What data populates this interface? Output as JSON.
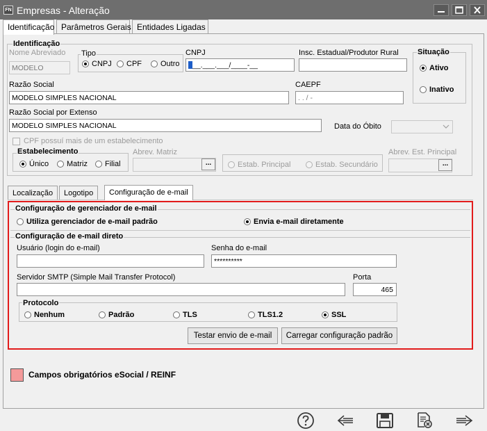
{
  "window": {
    "title": "Empresas - Alteração",
    "logo_text": "FN"
  },
  "top_tabs": [
    "Identificação",
    "Parâmetros Gerais",
    "Entidades Ligadas"
  ],
  "identificacao": {
    "section_label": "Identificação",
    "nome_abreviado_label": "Nome Abreviado",
    "nome_abreviado_value": "MODELO",
    "tipo_label": "Tipo",
    "tipo_options": [
      "CNPJ",
      "CPF",
      "Outro"
    ],
    "tipo_selected": "CNPJ",
    "cnpj_label": "CNPJ",
    "cnpj_mask": "__.___.___/____-__",
    "insc_label": "Insc. Estadual/Produtor Rural",
    "insc_value": "",
    "situacao_label": "Situação",
    "situacao_options": [
      "Ativo",
      "Inativo"
    ],
    "situacao_selected": "Ativo",
    "razao_social_label": "Razão Social",
    "razao_social_value": "MODELO SIMPLES NACIONAL",
    "caepf_label": "CAEPF",
    "caepf_mask": " .  .  /  -",
    "razao_extenso_label": "Razão Social por Extenso",
    "razao_extenso_value": "MODELO SIMPLES NACIONAL",
    "data_obito_label": "Data do Óbito",
    "data_obito_value": "",
    "cpf_mais_label": "CPF possuí mais de um estabelecimento",
    "estabelecimento_label": "Estabelecimento",
    "estabelecimento_options": [
      "Único",
      "Matriz",
      "Filial"
    ],
    "estabelecimento_selected": "Único",
    "abrev_matriz_label": "Abrev. Matriz",
    "estab_options": [
      "Estab. Principal",
      "Estab. Secundário"
    ],
    "abrev_est_principal_label": "Abrev. Est. Principal",
    "ellipsis": "..."
  },
  "sub_tabs": [
    "Localização",
    "Logotipo",
    "Configuração de e-mail"
  ],
  "email": {
    "gerenciador_label": "Configuração de gerenciador de e-mail",
    "gerenciador_options": [
      "Utiliza gerenciador de e-mail padrão",
      "Envia e-mail diretamente"
    ],
    "gerenciador_selected": "Envia e-mail diretamente",
    "direto_label": "Configuração de e-mail direto",
    "usuario_label": "Usuário (login do e-mail)",
    "usuario_value": "",
    "senha_label": "Senha do e-mail",
    "senha_value": "**********",
    "smtp_label": "Servidor SMTP (Simple Mail Transfer Protocol)",
    "smtp_value": "",
    "porta_label": "Porta",
    "porta_value": "465",
    "protocolo_label": "Protocolo",
    "protocolo_options": [
      "Nenhum",
      "Padrão",
      "TLS",
      "TLS1.2",
      "SSL"
    ],
    "protocolo_selected": "SSL",
    "testar_button": "Testar envio de e-mail",
    "carregar_button": "Carregar configuração padrão"
  },
  "legend": {
    "text": "Campos obrigatórios eSocial / REINF",
    "color": "#f49a9a"
  },
  "footer_icons": [
    "help-icon",
    "back-arrow-icon",
    "save-icon",
    "cancel-document-icon",
    "forward-arrow-icon"
  ]
}
